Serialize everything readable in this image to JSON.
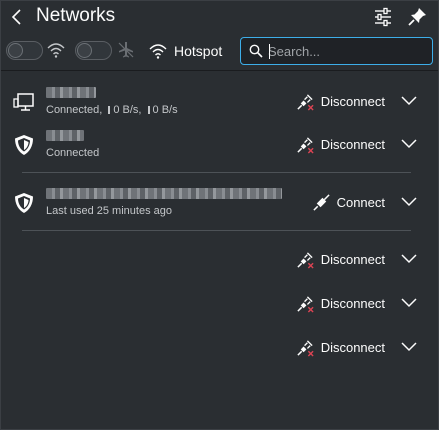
{
  "header": {
    "title": "Networks",
    "back_icon": "chevron-left-icon",
    "settings_icon": "configure-icon",
    "pin_icon": "pin-icon"
  },
  "toolbar": {
    "wifi_toggle": {
      "enabled": false,
      "icon": "wifi-icon"
    },
    "airplane_toggle": {
      "enabled": false,
      "icon": "airplane-mode-icon"
    },
    "hotspot_label": "Hotspot",
    "hotspot_icon": "wifi-hotspot-icon",
    "search_placeholder": "Search...",
    "search_value": ""
  },
  "networks": [
    {
      "type": "wired",
      "icon": "wired-network-icon",
      "status_prefix": "Connected,",
      "download": "0 B/s,",
      "upload": "0 B/s",
      "action": "Disconnect",
      "action_icon": "disconnect-plug-icon"
    },
    {
      "type": "vpn",
      "icon": "vpn-shield-icon",
      "status": "Connected",
      "action": "Disconnect",
      "action_icon": "disconnect-plug-icon"
    },
    {
      "type": "vpn",
      "icon": "vpn-shield-icon",
      "status": "Last used 25 minutes ago",
      "action": "Connect",
      "action_icon": "connect-plug-icon"
    },
    {
      "type": "unnamed",
      "status": "",
      "action": "Disconnect",
      "action_icon": "disconnect-plug-icon"
    },
    {
      "type": "unnamed",
      "status": "",
      "action": "Disconnect",
      "action_icon": "disconnect-plug-icon"
    },
    {
      "type": "unnamed",
      "status": "",
      "action": "Disconnect",
      "action_icon": "disconnect-plug-icon"
    }
  ],
  "colors": {
    "background": "#2a2e32",
    "accent": "#3daee9",
    "text": "#fcfcfc",
    "disconnect_mark": "#da4453"
  }
}
